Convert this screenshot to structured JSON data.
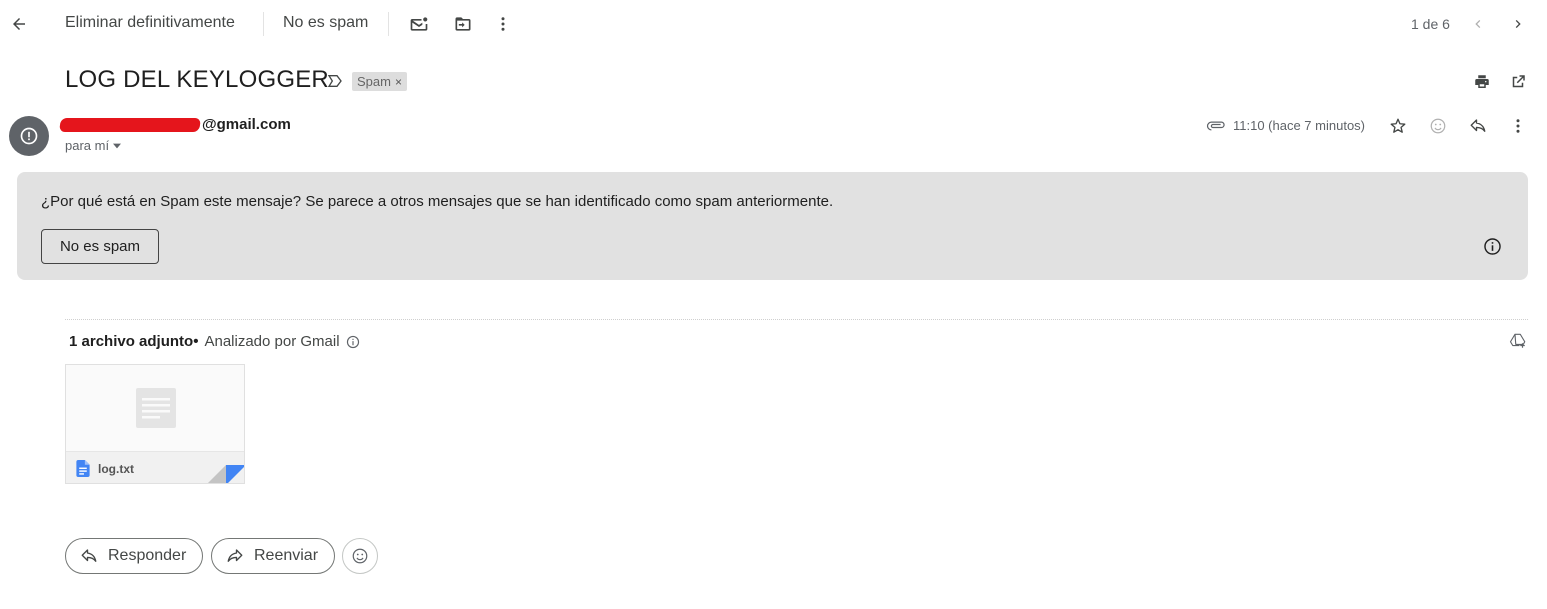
{
  "toolbar": {
    "delete_forever_label": "Eliminar definitivamente",
    "not_spam_label": "No es spam",
    "pager_text": "1 de 6"
  },
  "message": {
    "subject": "LOG DEL KEYLOGGER",
    "label_chip": "Spam",
    "label_chip_remove": "×",
    "sender_email_suffix": "@gmail.com",
    "to_me": "para mí",
    "time": "11:10 (hace 7 minutos)"
  },
  "spam_notice": {
    "question": "¿Por qué está en Spam este mensaje?",
    "explanation": " Se parece a otros mensajes que se han identificado como spam anteriormente.",
    "button_label": "No es spam"
  },
  "attachments": {
    "count_label": "1 archivo adjunto",
    "separator": "•",
    "scanned_label": "Analizado por Gmail",
    "files": [
      {
        "name": "log.txt",
        "type_icon": "doc-icon"
      }
    ]
  },
  "actions": {
    "reply_label": "Responder",
    "forward_label": "Reenviar"
  },
  "colors": {
    "redaction": "#e5151c",
    "spam_box_bg": "#e1e1e1",
    "doc_blue": "#4285f4"
  }
}
